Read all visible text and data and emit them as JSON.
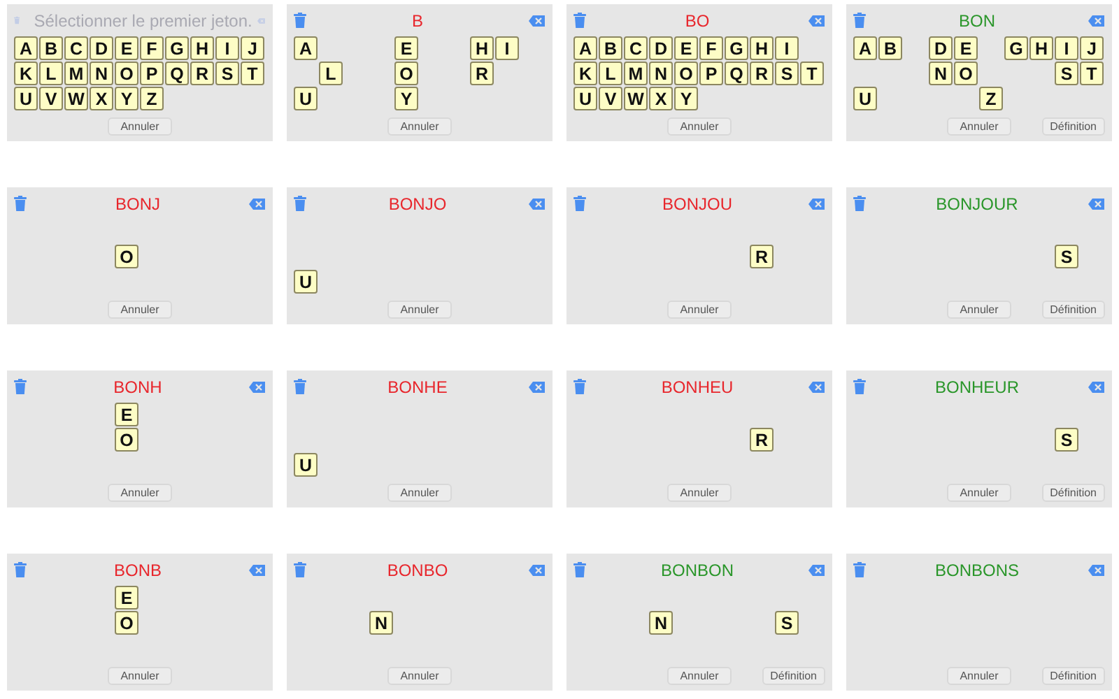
{
  "panels": [
    {
      "prompt": "Sélectionner le premier jeton.",
      "icons_enabled": false,
      "grid": [
        [
          {
            "kind": "tile",
            "letter": "A"
          },
          {
            "kind": "tile",
            "letter": "B"
          },
          {
            "kind": "tile",
            "letter": "C"
          },
          {
            "kind": "tile",
            "letter": "D"
          },
          {
            "kind": "tile",
            "letter": "E"
          },
          {
            "kind": "tile",
            "letter": "F"
          },
          {
            "kind": "tile",
            "letter": "G"
          },
          {
            "kind": "tile",
            "letter": "H"
          },
          {
            "kind": "tile",
            "letter": "I"
          },
          {
            "kind": "tile",
            "letter": "J"
          }
        ],
        [
          {
            "kind": "tile",
            "letter": "K"
          },
          {
            "kind": "tile",
            "letter": "L"
          },
          {
            "kind": "tile",
            "letter": "M"
          },
          {
            "kind": "tile",
            "letter": "N"
          },
          {
            "kind": "tile",
            "letter": "O"
          },
          {
            "kind": "tile",
            "letter": "P"
          },
          {
            "kind": "tile",
            "letter": "Q"
          },
          {
            "kind": "tile",
            "letter": "R"
          },
          {
            "kind": "tile",
            "letter": "S"
          },
          {
            "kind": "tile",
            "letter": "T"
          }
        ],
        [
          {
            "kind": "tile",
            "letter": "U"
          },
          {
            "kind": "tile",
            "letter": "V"
          },
          {
            "kind": "tile",
            "letter": "W"
          },
          {
            "kind": "tile",
            "letter": "X"
          },
          {
            "kind": "tile",
            "letter": "Y"
          },
          {
            "kind": "tile",
            "letter": "Z"
          }
        ]
      ],
      "buttons": [
        "Annuler"
      ]
    },
    {
      "title": "B",
      "is_word": false,
      "icons_enabled": true,
      "grid": [
        [
          {
            "kind": "tile",
            "letter": "A"
          },
          {
            "kind": "gap"
          },
          {
            "kind": "gap"
          },
          {
            "kind": "gap"
          },
          {
            "kind": "tile",
            "letter": "E"
          },
          {
            "kind": "gap"
          },
          {
            "kind": "gap"
          },
          {
            "kind": "tile",
            "letter": "H"
          },
          {
            "kind": "tile",
            "letter": "I"
          }
        ],
        [
          {
            "kind": "gap"
          },
          {
            "kind": "tile",
            "letter": "L"
          },
          {
            "kind": "gap"
          },
          {
            "kind": "gap"
          },
          {
            "kind": "tile",
            "letter": "O"
          },
          {
            "kind": "gap"
          },
          {
            "kind": "gap"
          },
          {
            "kind": "tile",
            "letter": "R"
          }
        ],
        [
          {
            "kind": "tile",
            "letter": "U"
          },
          {
            "kind": "gap"
          },
          {
            "kind": "gap"
          },
          {
            "kind": "gap"
          },
          {
            "kind": "tile",
            "letter": "Y"
          }
        ]
      ],
      "buttons": [
        "Annuler"
      ]
    },
    {
      "title": "BO",
      "is_word": false,
      "icons_enabled": true,
      "grid": [
        [
          {
            "kind": "tile",
            "letter": "A"
          },
          {
            "kind": "tile",
            "letter": "B"
          },
          {
            "kind": "tile",
            "letter": "C"
          },
          {
            "kind": "tile",
            "letter": "D"
          },
          {
            "kind": "tile",
            "letter": "E"
          },
          {
            "kind": "tile",
            "letter": "F"
          },
          {
            "kind": "tile",
            "letter": "G"
          },
          {
            "kind": "tile",
            "letter": "H"
          },
          {
            "kind": "tile",
            "letter": "I"
          }
        ],
        [
          {
            "kind": "tile",
            "letter": "K"
          },
          {
            "kind": "tile",
            "letter": "L"
          },
          {
            "kind": "tile",
            "letter": "M"
          },
          {
            "kind": "tile",
            "letter": "N"
          },
          {
            "kind": "tile",
            "letter": "O"
          },
          {
            "kind": "tile",
            "letter": "P"
          },
          {
            "kind": "tile",
            "letter": "Q"
          },
          {
            "kind": "tile",
            "letter": "R"
          },
          {
            "kind": "tile",
            "letter": "S"
          },
          {
            "kind": "tile",
            "letter": "T"
          }
        ],
        [
          {
            "kind": "tile",
            "letter": "U"
          },
          {
            "kind": "tile",
            "letter": "V"
          },
          {
            "kind": "tile",
            "letter": "W"
          },
          {
            "kind": "tile",
            "letter": "X"
          },
          {
            "kind": "tile",
            "letter": "Y"
          }
        ]
      ],
      "buttons": [
        "Annuler"
      ]
    },
    {
      "title": "BON",
      "is_word": true,
      "icons_enabled": true,
      "grid": [
        [
          {
            "kind": "tile",
            "letter": "A"
          },
          {
            "kind": "tile",
            "letter": "B"
          },
          {
            "kind": "gap"
          },
          {
            "kind": "tile",
            "letter": "D"
          },
          {
            "kind": "tile",
            "letter": "E"
          },
          {
            "kind": "gap"
          },
          {
            "kind": "tile",
            "letter": "G"
          },
          {
            "kind": "tile",
            "letter": "H"
          },
          {
            "kind": "tile",
            "letter": "I"
          },
          {
            "kind": "tile",
            "letter": "J"
          }
        ],
        [
          {
            "kind": "gap"
          },
          {
            "kind": "gap"
          },
          {
            "kind": "gap"
          },
          {
            "kind": "tile",
            "letter": "N"
          },
          {
            "kind": "tile",
            "letter": "O"
          },
          {
            "kind": "gap"
          },
          {
            "kind": "gap"
          },
          {
            "kind": "gap"
          },
          {
            "kind": "tile",
            "letter": "S"
          },
          {
            "kind": "tile",
            "letter": "T"
          }
        ],
        [
          {
            "kind": "tile",
            "letter": "U"
          },
          {
            "kind": "gap"
          },
          {
            "kind": "gap"
          },
          {
            "kind": "gap"
          },
          {
            "kind": "gap"
          },
          {
            "kind": "tile",
            "letter": "Z"
          }
        ]
      ],
      "buttons": [
        "Annuler",
        "Définition"
      ]
    },
    {
      "title": "BONJ",
      "is_word": false,
      "icons_enabled": true,
      "grid": [
        [
          {
            "kind": "gap"
          }
        ],
        [
          {
            "kind": "gap"
          },
          {
            "kind": "gap"
          },
          {
            "kind": "gap"
          },
          {
            "kind": "gap"
          },
          {
            "kind": "tile",
            "letter": "O"
          }
        ]
      ],
      "buttons": [
        "Annuler"
      ]
    },
    {
      "title": "BONJO",
      "is_word": false,
      "icons_enabled": true,
      "grid": [
        [
          {
            "kind": "gap"
          }
        ],
        [
          {
            "kind": "gap"
          }
        ],
        [
          {
            "kind": "tile",
            "letter": "U"
          }
        ]
      ],
      "buttons": [
        "Annuler"
      ]
    },
    {
      "title": "BONJOU",
      "is_word": false,
      "icons_enabled": true,
      "grid": [
        [
          {
            "kind": "gap"
          }
        ],
        [
          {
            "kind": "gap"
          },
          {
            "kind": "gap"
          },
          {
            "kind": "gap"
          },
          {
            "kind": "gap"
          },
          {
            "kind": "gap"
          },
          {
            "kind": "gap"
          },
          {
            "kind": "gap"
          },
          {
            "kind": "tile",
            "letter": "R"
          }
        ]
      ],
      "buttons": [
        "Annuler"
      ]
    },
    {
      "title": "BONJOUR",
      "is_word": true,
      "icons_enabled": true,
      "grid": [
        [
          {
            "kind": "gap"
          }
        ],
        [
          {
            "kind": "gap"
          },
          {
            "kind": "gap"
          },
          {
            "kind": "gap"
          },
          {
            "kind": "gap"
          },
          {
            "kind": "gap"
          },
          {
            "kind": "gap"
          },
          {
            "kind": "gap"
          },
          {
            "kind": "gap"
          },
          {
            "kind": "tile",
            "letter": "S"
          }
        ]
      ],
      "buttons": [
        "Annuler",
        "Définition"
      ]
    },
    {
      "title": "BONH",
      "is_word": false,
      "icons_enabled": true,
      "grid": [
        [
          {
            "kind": "gap"
          },
          {
            "kind": "gap"
          },
          {
            "kind": "gap"
          },
          {
            "kind": "gap"
          },
          {
            "kind": "tile",
            "letter": "E"
          }
        ],
        [
          {
            "kind": "gap"
          },
          {
            "kind": "gap"
          },
          {
            "kind": "gap"
          },
          {
            "kind": "gap"
          },
          {
            "kind": "tile",
            "letter": "O"
          }
        ]
      ],
      "buttons": [
        "Annuler"
      ]
    },
    {
      "title": "BONHE",
      "is_word": false,
      "icons_enabled": true,
      "grid": [
        [
          {
            "kind": "gap"
          }
        ],
        [
          {
            "kind": "gap"
          }
        ],
        [
          {
            "kind": "tile",
            "letter": "U"
          }
        ]
      ],
      "buttons": [
        "Annuler"
      ]
    },
    {
      "title": "BONHEU",
      "is_word": false,
      "icons_enabled": true,
      "grid": [
        [
          {
            "kind": "gap"
          }
        ],
        [
          {
            "kind": "gap"
          },
          {
            "kind": "gap"
          },
          {
            "kind": "gap"
          },
          {
            "kind": "gap"
          },
          {
            "kind": "gap"
          },
          {
            "kind": "gap"
          },
          {
            "kind": "gap"
          },
          {
            "kind": "tile",
            "letter": "R"
          }
        ]
      ],
      "buttons": [
        "Annuler"
      ]
    },
    {
      "title": "BONHEUR",
      "is_word": true,
      "icons_enabled": true,
      "grid": [
        [
          {
            "kind": "gap"
          }
        ],
        [
          {
            "kind": "gap"
          },
          {
            "kind": "gap"
          },
          {
            "kind": "gap"
          },
          {
            "kind": "gap"
          },
          {
            "kind": "gap"
          },
          {
            "kind": "gap"
          },
          {
            "kind": "gap"
          },
          {
            "kind": "gap"
          },
          {
            "kind": "tile",
            "letter": "S"
          }
        ]
      ],
      "buttons": [
        "Annuler",
        "Définition"
      ]
    },
    {
      "title": "BONB",
      "is_word": false,
      "icons_enabled": true,
      "grid": [
        [
          {
            "kind": "gap"
          },
          {
            "kind": "gap"
          },
          {
            "kind": "gap"
          },
          {
            "kind": "gap"
          },
          {
            "kind": "tile",
            "letter": "E"
          }
        ],
        [
          {
            "kind": "gap"
          },
          {
            "kind": "gap"
          },
          {
            "kind": "gap"
          },
          {
            "kind": "gap"
          },
          {
            "kind": "tile",
            "letter": "O"
          }
        ]
      ],
      "buttons": [
        "Annuler"
      ]
    },
    {
      "title": "BONBO",
      "is_word": false,
      "icons_enabled": true,
      "grid": [
        [
          {
            "kind": "gap"
          }
        ],
        [
          {
            "kind": "gap"
          },
          {
            "kind": "gap"
          },
          {
            "kind": "gap"
          },
          {
            "kind": "tile",
            "letter": "N"
          }
        ]
      ],
      "buttons": [
        "Annuler"
      ]
    },
    {
      "title": "BONBON",
      "is_word": true,
      "icons_enabled": true,
      "grid": [
        [
          {
            "kind": "gap"
          }
        ],
        [
          {
            "kind": "gap"
          },
          {
            "kind": "gap"
          },
          {
            "kind": "gap"
          },
          {
            "kind": "tile",
            "letter": "N"
          },
          {
            "kind": "gap"
          },
          {
            "kind": "gap"
          },
          {
            "kind": "gap"
          },
          {
            "kind": "gap"
          },
          {
            "kind": "tile",
            "letter": "S"
          }
        ]
      ],
      "buttons": [
        "Annuler",
        "Définition"
      ]
    },
    {
      "title": "BONBONS",
      "is_word": true,
      "icons_enabled": true,
      "buttons": [
        "Annuler",
        "Définition"
      ]
    }
  ]
}
